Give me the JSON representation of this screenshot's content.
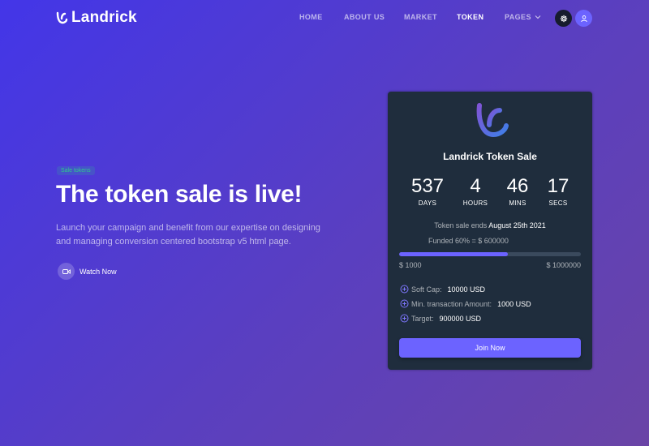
{
  "brand": {
    "name": "Landrick"
  },
  "nav": {
    "items": [
      {
        "label": "HOME"
      },
      {
        "label": "ABOUT US"
      },
      {
        "label": "MARKET"
      },
      {
        "label": "TOKEN"
      },
      {
        "label": "PAGES"
      }
    ],
    "active": "TOKEN"
  },
  "hero": {
    "badge": "Sale tokens",
    "title": "The token sale is live!",
    "description": "Launch your campaign and benefit from our expertise on designing and managing conversion centered bootstrap v5 html page.",
    "watch_label": "Watch Now"
  },
  "card": {
    "title": "Landrick Token Sale",
    "countdown": [
      {
        "value": "537",
        "label": "DAYS"
      },
      {
        "value": "4",
        "label": "HOURS"
      },
      {
        "value": "46",
        "label": "MINS"
      },
      {
        "value": "17",
        "label": "SECS"
      }
    ],
    "ends_prefix": "Token sale ends",
    "ends_date": "August 25th 2021",
    "funded_text": "Funded 60% = $ 600000",
    "funded_fraction": 0.6,
    "range_min": "$ 1000",
    "range_max": "$ 1000000",
    "stats": [
      {
        "key": "Soft Cap:",
        "value": "10000 USD"
      },
      {
        "key": "Min. transaction Amount:",
        "value": "1000 USD"
      },
      {
        "key": "Target:",
        "value": "900000 USD"
      }
    ],
    "join_label": "Join Now"
  },
  "colors": {
    "accent": "#6c63ff",
    "card_bg": "#1f2d3d",
    "badge_green": "#2eca8b"
  },
  "icons": [
    "landrick-logo-icon",
    "chevron-down-icon",
    "gear-icon",
    "user-icon",
    "video-icon",
    "plus-circle-icon"
  ]
}
